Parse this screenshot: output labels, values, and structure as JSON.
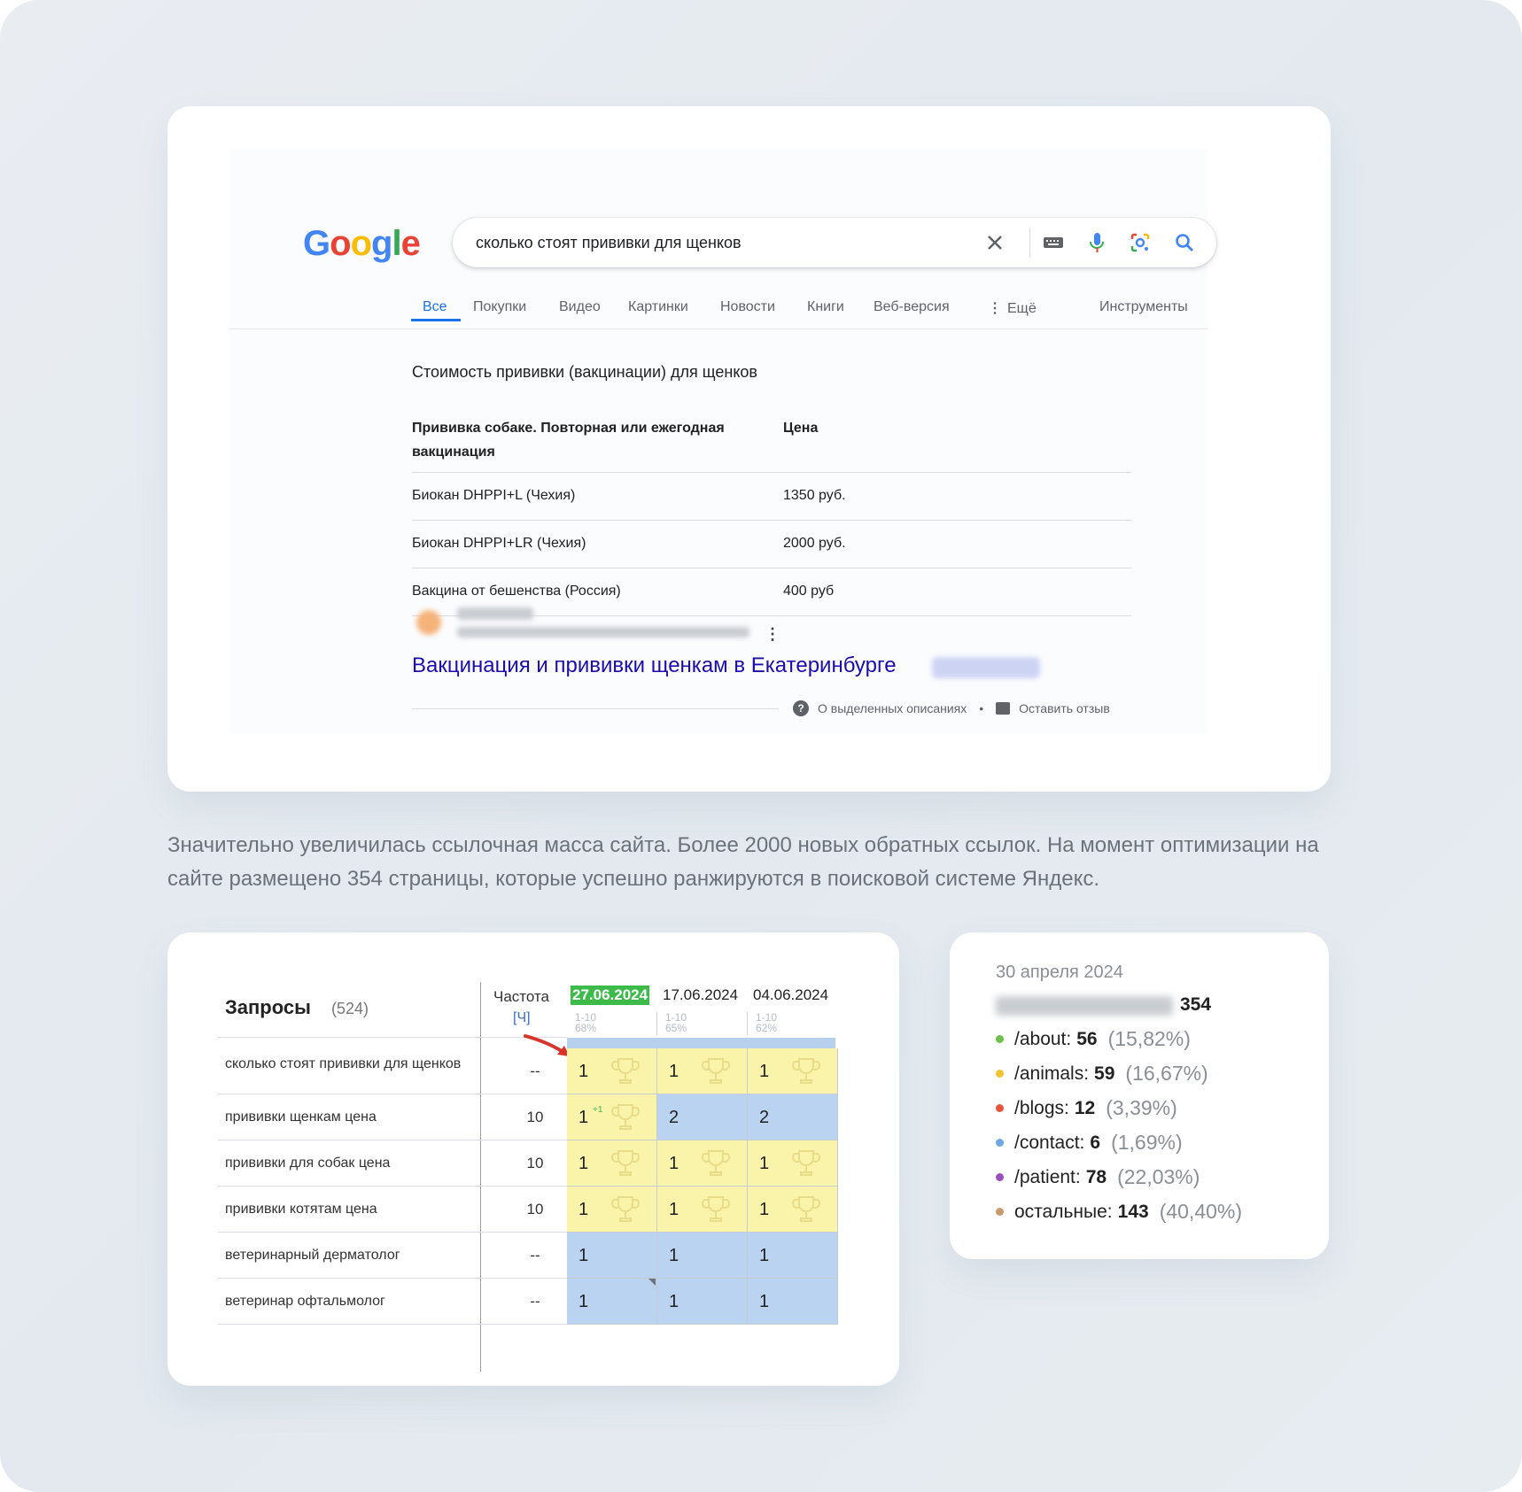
{
  "google": {
    "logo": "Google",
    "query": "сколько стоят прививки для щенков",
    "tabs": [
      "Все",
      "Покупки",
      "Видео",
      "Картинки",
      "Новости",
      "Книги",
      "Веб-версия",
      "Ещё"
    ],
    "tools": "Инструменты",
    "snippet_title": "Стоимость прививки (вакцинации) для щенков",
    "table": {
      "headers": [
        "Прививка собаке. Повторная или ежегодная вакцинация",
        "Цена"
      ],
      "rows": [
        [
          "Биокан DHPPI+L (Чехия)",
          "1350 руб."
        ],
        [
          "Биокан DHPPI+LR (Чехия)",
          "2000 руб."
        ],
        [
          "Вакцина от бешенства (Россия)",
          "400 руб"
        ]
      ]
    },
    "result_link": "Вакцинация и прививки щенкам в Екатеринбурге",
    "footer": {
      "about": "О выделенных описаниях",
      "feedback": "Оставить отзыв"
    }
  },
  "paragraph": "Значительно увеличилась ссылочная масса сайта. Более 2000 новых обратных ссылок. На момент оптимизации на сайте размещено 354 страницы, которые успешно ранжируются в поисковой системе Яндекс.",
  "ranking": {
    "title": "Запросы",
    "count": "(524)",
    "freq_label": "Частота",
    "freq_link": "[Ч]",
    "dates": [
      {
        "date": "27.06.2024",
        "range": "1-10",
        "pct": "68%"
      },
      {
        "date": "17.06.2024",
        "range": "1-10",
        "pct": "65%"
      },
      {
        "date": "04.06.2024",
        "range": "1-10",
        "pct": "62%"
      }
    ],
    "rows": [
      {
        "query": "сколько стоят прививки для щенков",
        "freq": "--",
        "cells": [
          {
            "v": "1",
            "c": "yellow",
            "t": true
          },
          {
            "v": "1",
            "c": "yellow",
            "t": true
          },
          {
            "v": "1",
            "c": "yellow",
            "t": true
          }
        ]
      },
      {
        "query": "прививки щенкам цена",
        "freq": "10",
        "cells": [
          {
            "v": "1",
            "c": "yellow",
            "t": true,
            "sup": "+1"
          },
          {
            "v": "2",
            "c": "blue",
            "t": false
          },
          {
            "v": "2",
            "c": "blue",
            "t": false
          }
        ]
      },
      {
        "query": "прививки для собак цена",
        "freq": "10",
        "cells": [
          {
            "v": "1",
            "c": "yellow",
            "t": true
          },
          {
            "v": "1",
            "c": "yellow",
            "t": true
          },
          {
            "v": "1",
            "c": "yellow",
            "t": true
          }
        ]
      },
      {
        "query": "прививки котятам цена",
        "freq": "10",
        "cells": [
          {
            "v": "1",
            "c": "yellow",
            "t": true
          },
          {
            "v": "1",
            "c": "yellow",
            "t": true
          },
          {
            "v": "1",
            "c": "yellow",
            "t": true
          }
        ]
      },
      {
        "query": "ветеринарный дерматолог",
        "freq": "--",
        "cells": [
          {
            "v": "1",
            "c": "blue",
            "t": false
          },
          {
            "v": "1",
            "c": "blue",
            "t": false
          },
          {
            "v": "1",
            "c": "blue",
            "t": false
          }
        ]
      },
      {
        "query": "ветеринар офтальмолог",
        "freq": "--",
        "cells": [
          {
            "v": "1",
            "c": "blue",
            "t": false
          },
          {
            "v": "1",
            "c": "blue",
            "t": false
          },
          {
            "v": "1",
            "c": "blue",
            "t": false
          }
        ]
      }
    ]
  },
  "stats": {
    "date": "30 апреля 2024",
    "total": "354",
    "items": [
      {
        "path": "/about:",
        "count": "56",
        "pct": "(15,82%)",
        "color": "#6cc04a"
      },
      {
        "path": "/animals:",
        "count": "59",
        "pct": "(16,67%)",
        "color": "#f4c430"
      },
      {
        "path": "/blogs:",
        "count": "12",
        "pct": "(3,39%)",
        "color": "#e8553d"
      },
      {
        "path": "/contact:",
        "count": "6",
        "pct": "(1,69%)",
        "color": "#6fa8e0"
      },
      {
        "path": "/patient:",
        "count": "78",
        "pct": "(22,03%)",
        "color": "#9a4fbf"
      },
      {
        "path": "остальные:",
        "count": "143",
        "pct": "(40,40%)",
        "color": "#c8996a"
      }
    ]
  }
}
